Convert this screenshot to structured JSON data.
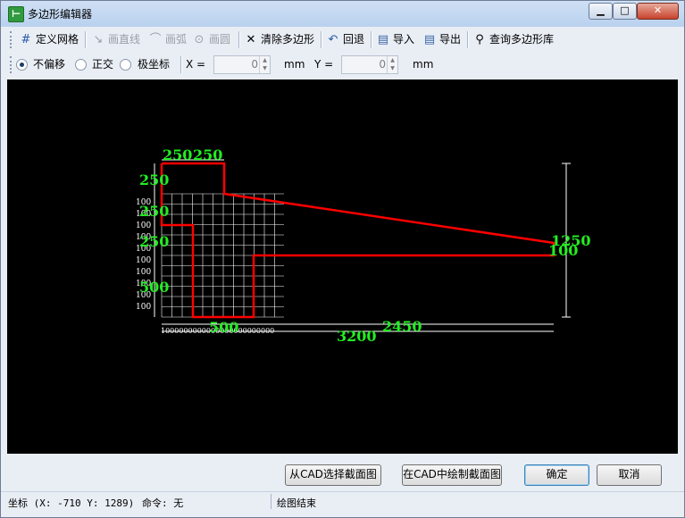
{
  "window": {
    "title": "多边形编辑器",
    "app_icon": "polygon-editor-icon",
    "title_buttons": [
      "minimize",
      "maximize",
      "close"
    ]
  },
  "toolbar": {
    "define_grid": "定义网格",
    "draw_line": "画直线",
    "draw_arc": "画弧",
    "draw_circle": "画圆",
    "clear_polygon": "清除多边形",
    "undo": "回退",
    "import": "导入",
    "export": "导出",
    "query_polygon_lib": "查询多边形库"
  },
  "offset_bar": {
    "options": [
      {
        "label": "不偏移",
        "checked": true
      },
      {
        "label": "正交",
        "checked": false
      },
      {
        "label": "极坐标",
        "checked": false
      }
    ],
    "x_label": "X =",
    "x_value": "0",
    "x_unit": "mm",
    "y_label": "Y =",
    "y_value": "0",
    "y_unit": "mm"
  },
  "drawing": {
    "polygon_color": "#ff0000",
    "dimension_color": "#00ff00",
    "grid_color": "#ffffff",
    "background": "#000000",
    "dims": {
      "top_left": "250",
      "top_right": "250",
      "left_1": "250",
      "left_2": "250",
      "left_3": "250",
      "left_4": "500",
      "bottom_width": "500",
      "total_width": "3200",
      "right_width": "2450",
      "right_height": "1250",
      "right_small": "100"
    },
    "grid_labels_left": [
      "100",
      "100",
      "100",
      "100",
      "100",
      "100",
      "100",
      "100",
      "100",
      "100"
    ],
    "grid_labels_bottom": "1000000000000000000000000"
  },
  "buttons": {
    "select_from_cad": "从CAD选择截面图",
    "draw_in_cad": "在CAD中绘制截面图",
    "ok": "确定",
    "cancel": "取消"
  },
  "status": {
    "coords": "坐标 (X: -710 Y: 1289)",
    "command": "命令: 无",
    "message": "绘图结束"
  }
}
